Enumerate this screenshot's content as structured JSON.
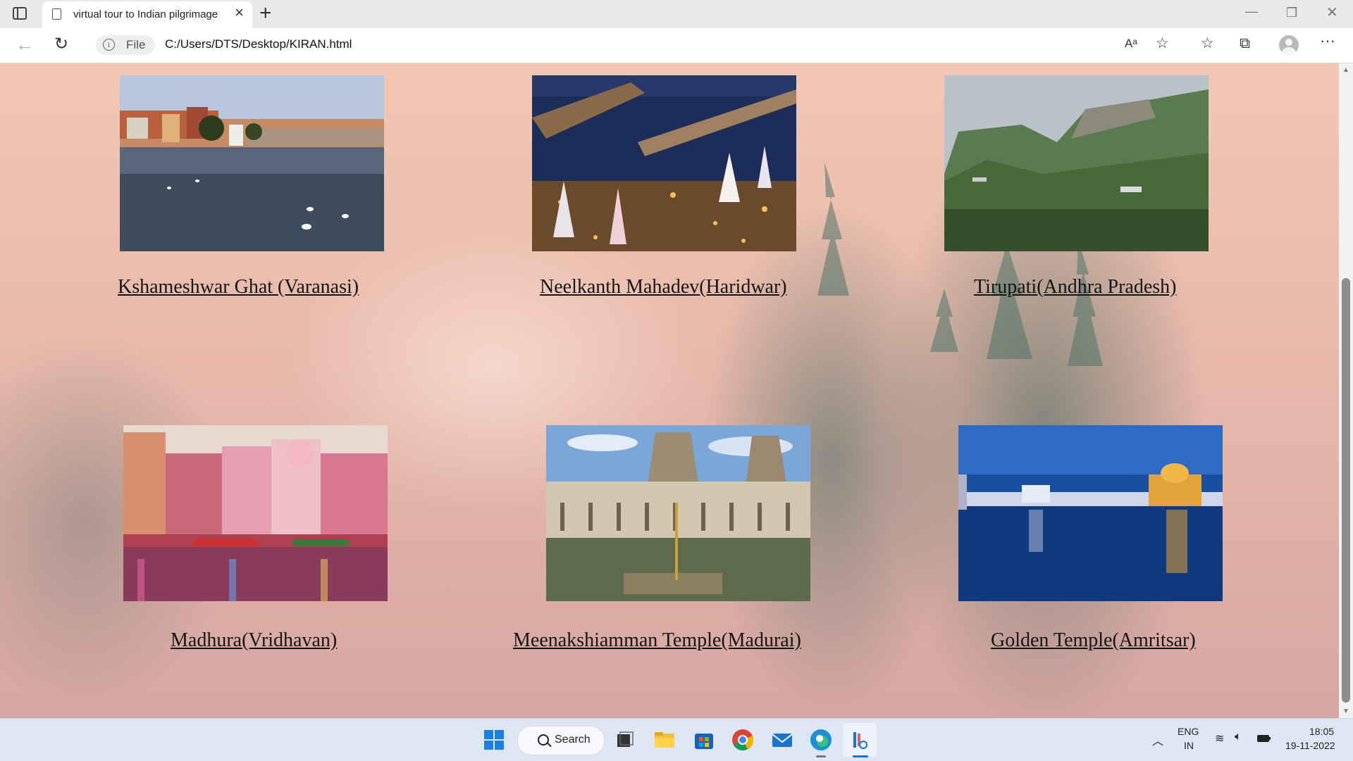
{
  "browser": {
    "tab_title": "virtual tour to Indian pilgrimage",
    "address_scheme_label": "File",
    "url": "C:/Users/DTS/Desktop/KIRAN.html"
  },
  "places": [
    {
      "name": "Kshameshwar Ghat (Varanasi)",
      "photo": "varanasi-ghat-photo"
    },
    {
      "name": "Neelkanth Mahadev(Haridwar)",
      "photo": "haridwar-night-ghat-photo"
    },
    {
      "name": "Tirupati(Andhra Pradesh)",
      "photo": "tirumala-hills-photo"
    },
    {
      "name": "Madhura(Vridhavan)",
      "photo": "mathura-ghat-photo"
    },
    {
      "name": "Meenakshiamman Temple(Madurai)",
      "photo": "madurai-temple-tank-photo"
    },
    {
      "name": "Golden Temple(Amritsar)",
      "photo": "golden-temple-photo"
    }
  ],
  "taskbar": {
    "search_label": "Search",
    "language_line1": "ENG",
    "language_line2": "IN",
    "time": "18:05",
    "date": "19-11-2022"
  },
  "colors": {
    "page_bg": "#f2c7b3",
    "taskbar_bg": "#dde6f3",
    "caption_color": "#151515"
  }
}
